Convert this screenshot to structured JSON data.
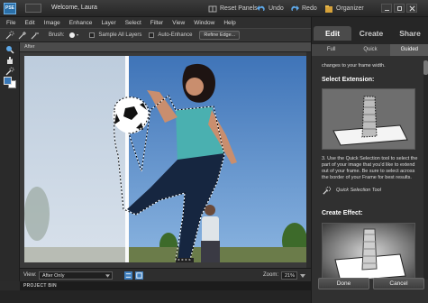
{
  "app": {
    "logo_text": "PSE",
    "welcome": "Welcome, Laura"
  },
  "titlebar": {
    "reset_panels": "Reset Panels",
    "undo": "Undo",
    "redo": "Redo",
    "organizer": "Organizer"
  },
  "menubar": {
    "items": [
      "File",
      "Edit",
      "Image",
      "Enhance",
      "Layer",
      "Select",
      "Filter",
      "View",
      "Window",
      "Help"
    ]
  },
  "options": {
    "brush_label": "Brush:",
    "sample_all_layers": "Sample All Layers",
    "auto_enhance": "Auto-Enhance",
    "refine_edge": "Refine Edge..."
  },
  "document": {
    "tab_label": "After"
  },
  "statusbar": {
    "view_label": "View:",
    "view_value": "After Only",
    "zoom_label": "Zoom:",
    "zoom_value": "21%"
  },
  "project_bin": {
    "label": "PROJECT BIN"
  },
  "panel": {
    "tabs": [
      "Edit",
      "Create",
      "Share"
    ],
    "active_tab": "Edit",
    "subtabs": [
      "Full",
      "Quick",
      "Guided"
    ],
    "active_subtab": "Guided",
    "intro_text": "changes to your frame width.",
    "select_extension_title": "Select Extension:",
    "step3_text": "3. Use the Quick Selection tool to select the part of your image that you'd like to extend out of your frame. Be sure to select across the border of your Frame for best results.",
    "quick_selection_tool": "Quick Selection Tool",
    "create_effect_title": "Create Effect:",
    "done_button": "Done",
    "cancel_button": "Cancel"
  },
  "colors": {
    "accent": "#2a6fa8",
    "sky": "#4f86c6",
    "shirt": "#4ab0b0"
  }
}
